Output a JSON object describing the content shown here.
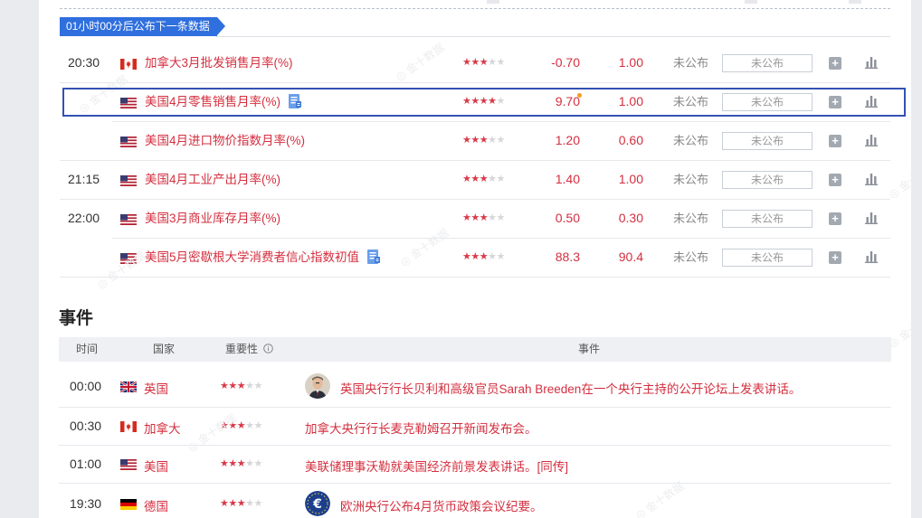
{
  "colors": {
    "accent_red": "#d42f3f",
    "banner_blue": "#2f6fde",
    "highlight_border": "#3452b4"
  },
  "banner": {
    "label": "01小时00分后公布下一条数据"
  },
  "data_rows": [
    {
      "time": "20:30",
      "flag": "ca",
      "name": "加拿大3月批发销售月率(%)",
      "stars": 3,
      "prev": "-0.70",
      "forecast": "1.00",
      "actual_status": "未公布",
      "input_placeholder": "未公布",
      "has_doc_icon": false
    },
    {
      "time": "",
      "flag": "us",
      "name": "美国4月零售销售月率(%)",
      "stars": 4,
      "prev": "9.70",
      "forecast": "1.00",
      "actual_status": "未公布",
      "input_placeholder": "未公布",
      "has_doc_icon": true,
      "highlighted": true
    },
    {
      "time": "",
      "flag": "us",
      "name": "美国4月进口物价指数月率(%)",
      "stars": 3,
      "prev": "1.20",
      "forecast": "0.60",
      "actual_status": "未公布",
      "input_placeholder": "未公布",
      "has_doc_icon": false
    },
    {
      "time": "21:15",
      "flag": "us",
      "name": "美国4月工业产出月率(%)",
      "stars": 3,
      "prev": "1.40",
      "forecast": "1.00",
      "actual_status": "未公布",
      "input_placeholder": "未公布",
      "has_doc_icon": false
    },
    {
      "time": "22:00",
      "flag": "us",
      "name": "美国3月商业库存月率(%)",
      "stars": 3,
      "prev": "0.50",
      "forecast": "0.30",
      "actual_status": "未公布",
      "input_placeholder": "未公布",
      "has_doc_icon": false
    },
    {
      "time": "",
      "flag": "us",
      "name": "美国5月密歇根大学消费者信心指数初值",
      "stars": 3,
      "prev": "88.3",
      "forecast": "90.4",
      "actual_status": "未公布",
      "input_placeholder": "未公布",
      "has_doc_icon": true
    }
  ],
  "events": {
    "title": "事件",
    "headers": {
      "time": "时间",
      "country": "国家",
      "importance": "重要性",
      "event": "事件"
    },
    "rows": [
      {
        "time": "00:00",
        "flag": "gb",
        "country": "英国",
        "stars": 3,
        "text": "英国央行行长贝利和高级官员Sarah Breeden在一个央行主持的公开论坛上发表讲话。",
        "avatar": "person"
      },
      {
        "time": "00:30",
        "flag": "ca",
        "country": "加拿大",
        "stars": 3,
        "text": "加拿大央行行长麦克勒姆召开新闻发布会。",
        "avatar": ""
      },
      {
        "time": "01:00",
        "flag": "us",
        "country": "美国",
        "stars": 3,
        "text": "美联储理事沃勒就美国经济前景发表讲话。[同传]",
        "avatar": ""
      },
      {
        "time": "19:30",
        "flag": "de",
        "country": "德国",
        "stars": 3,
        "text": "欧洲央行公布4月货币政策会议纪要。",
        "avatar": "ecb"
      }
    ]
  },
  "icons": {
    "plus": "add-icon",
    "bars": "bar-chart-icon",
    "doc": "document-icon",
    "info": "info-icon"
  }
}
